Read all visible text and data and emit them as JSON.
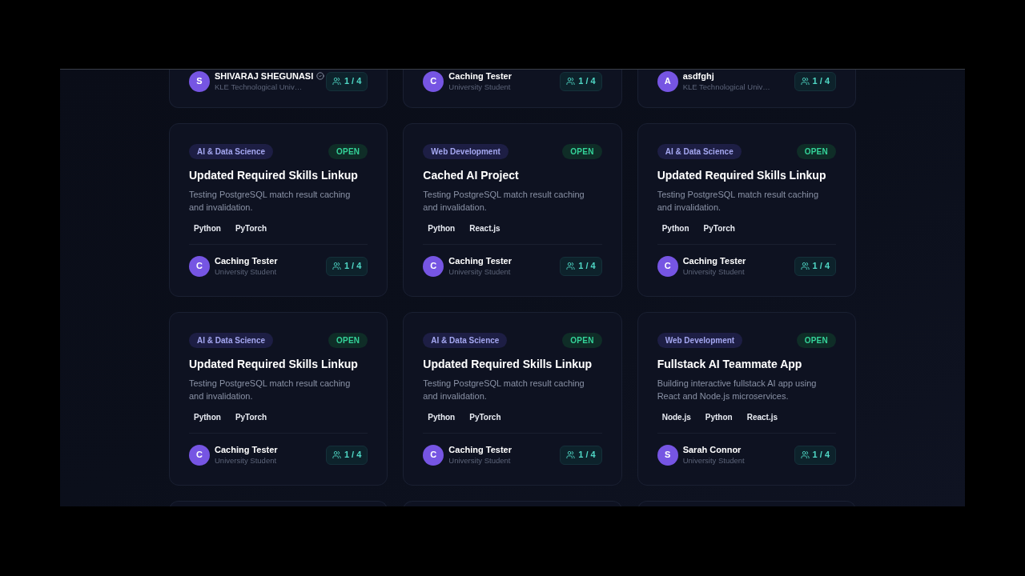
{
  "top_row": [
    {
      "owner": {
        "initial": "S",
        "name": "SHIVARAJ SHEGUNASI",
        "verified": true,
        "subtitle": "KLE Technological Univ…"
      },
      "members": "1 / 4"
    },
    {
      "owner": {
        "initial": "C",
        "name": "Caching Tester",
        "verified": false,
        "subtitle": "University Student"
      },
      "members": "1 / 4"
    },
    {
      "owner": {
        "initial": "A",
        "name": "asdfghj",
        "verified": false,
        "subtitle": "KLE Technological Univ…"
      },
      "members": "1 / 4"
    }
  ],
  "cards": [
    {
      "category": "AI & Data Science",
      "status": "OPEN",
      "title": "Updated Required Skills Linkup",
      "description": "Testing PostgreSQL match result caching and invalidation.",
      "skills": [
        "Python",
        "PyTorch"
      ],
      "owner": {
        "initial": "C",
        "name": "Caching Tester",
        "verified": false,
        "subtitle": "University Student"
      },
      "members": "1 / 4"
    },
    {
      "category": "Web Development",
      "status": "OPEN",
      "title": "Cached AI Project",
      "description": "Testing PostgreSQL match result caching and invalidation.",
      "skills": [
        "Python",
        "React.js"
      ],
      "owner": {
        "initial": "C",
        "name": "Caching Tester",
        "verified": false,
        "subtitle": "University Student"
      },
      "members": "1 / 4"
    },
    {
      "category": "AI & Data Science",
      "status": "OPEN",
      "title": "Updated Required Skills Linkup",
      "description": "Testing PostgreSQL match result caching and invalidation.",
      "skills": [
        "Python",
        "PyTorch"
      ],
      "owner": {
        "initial": "C",
        "name": "Caching Tester",
        "verified": false,
        "subtitle": "University Student"
      },
      "members": "1 / 4"
    },
    {
      "category": "AI & Data Science",
      "status": "OPEN",
      "title": "Updated Required Skills Linkup",
      "description": "Testing PostgreSQL match result caching and invalidation.",
      "skills": [
        "Python",
        "PyTorch"
      ],
      "owner": {
        "initial": "C",
        "name": "Caching Tester",
        "verified": false,
        "subtitle": "University Student"
      },
      "members": "1 / 4"
    },
    {
      "category": "AI & Data Science",
      "status": "OPEN",
      "title": "Updated Required Skills Linkup",
      "description": "Testing PostgreSQL match result caching and invalidation.",
      "skills": [
        "Python",
        "PyTorch"
      ],
      "owner": {
        "initial": "C",
        "name": "Caching Tester",
        "verified": false,
        "subtitle": "University Student"
      },
      "members": "1 / 4"
    },
    {
      "category": "Web Development",
      "status": "OPEN",
      "title": "Fullstack AI Teammate App",
      "description": "Building interactive fullstack AI app using React and Node.js microservices.",
      "skills": [
        "Node.js",
        "Python",
        "React.js"
      ],
      "owner": {
        "initial": "S",
        "name": "Sarah Connor",
        "verified": false,
        "subtitle": "University Student"
      },
      "members": "1 / 4"
    }
  ]
}
